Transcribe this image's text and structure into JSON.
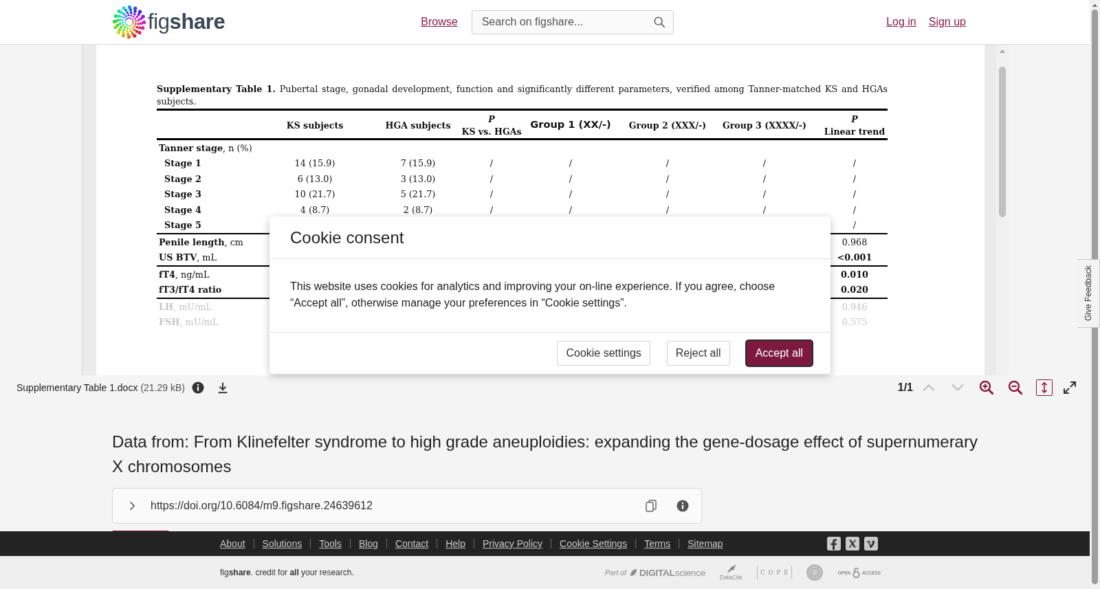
{
  "header": {
    "logo": "fig**share**",
    "nav_link": "Browse",
    "search": {
      "placeholder": "Search on figshare..."
    },
    "account_links": [
      "Log in",
      "Sign up"
    ]
  },
  "viewer": {
    "document": {
      "caption": "**Supplementary Table 1.** Pubertal stage, gonadal development, function and significantly different parameters, verified among Tanner-matched KS and HGAs subjects.",
      "columns": [
        {
          "text": "KS subjects",
          "kind": "serif"
        },
        {
          "text": "HGA subjects",
          "kind": "serif"
        },
        {
          "symbol": "P",
          "text": "KS vs. HGAs",
          "kind": "serif"
        },
        {
          "text": "Group 1 (XX/-)",
          "kind": "sans"
        },
        {
          "text": "Group 2 (XXX/-)",
          "kind": "serif"
        },
        {
          "text": "Group 3 (XXXX/-)",
          "kind": "serif"
        },
        {
          "symbol": "P",
          "text": "Linear trend",
          "kind": "serif"
        }
      ],
      "groups": [
        {
          "rows": [
            {
              "label": "**Tanner stage**, n (%)",
              "kind": "heading",
              "faded": false
            },
            {
              "label": "Stage 1",
              "kind": "sub",
              "faded": false,
              "values": [
                "14 (15.9)",
                "7 (15.9)",
                "/",
                "/",
                "/",
                "/",
                "/"
              ]
            },
            {
              "label": "Stage 2",
              "kind": "sub",
              "faded": false,
              "values": [
                "6 (13.0)",
                "3 (13.0)",
                "/",
                "/",
                "/",
                "/",
                "/"
              ]
            },
            {
              "label": "Stage 3",
              "kind": "sub",
              "faded": false,
              "values": [
                "10 (21.7)",
                "5 (21.7)",
                "/",
                "/",
                "/",
                "/",
                "/"
              ]
            },
            {
              "label": "Stage 4",
              "kind": "sub",
              "faded": false,
              "values": [
                "4 (8.7)",
                "2 (8.7)",
                "/",
                "/",
                "/",
                "/",
                "/"
              ]
            },
            {
              "label": "Stage 5",
              "kind": "sub",
              "faded": false,
              "p_linear_trend": "/",
              "significant": false
            }
          ]
        },
        {
          "rows": [
            {
              "label": "**Penile length**, cm",
              "kind": "item",
              "faded": false,
              "p_linear_trend": "0.968",
              "significant": false
            },
            {
              "label": "**US BTV**, mL",
              "kind": "item",
              "faded": false,
              "p_linear_trend": "<0.001",
              "significant": true
            }
          ]
        },
        {
          "rows": [
            {
              "label": "**fT4**, ng/mL",
              "kind": "item",
              "faded": false,
              "p_linear_trend": "0.010",
              "significant": true
            },
            {
              "label": "**fT3/fT4 ratio**",
              "kind": "item",
              "faded": false,
              "p_linear_trend": "0.020",
              "significant": true
            }
          ]
        },
        {
          "rows": [
            {
              "label": "**LH**, mU/mL",
              "kind": "item",
              "faded": true,
              "p_linear_trend": "0.946",
              "significant": false
            },
            {
              "label": "**FSH**, mU/mL",
              "kind": "item",
              "faded": true,
              "p_linear_trend": "0.575",
              "significant": false
            }
          ]
        }
      ]
    },
    "file": {
      "name": "Supplementary Table 1.docx",
      "size": "(21.29 kB)"
    },
    "page_indicator": "1/1",
    "tools": [
      {
        "kind": "previous",
        "disabled": true,
        "on": false
      },
      {
        "kind": "next",
        "disabled": true,
        "on": false
      },
      {
        "kind": "zoom-in",
        "disabled": false,
        "on": false
      },
      {
        "kind": "zoom-out",
        "disabled": false,
        "on": false
      },
      {
        "kind": "fit-height",
        "disabled": false,
        "on": true
      },
      {
        "kind": "fullscreen",
        "disabled": false,
        "on": false
      }
    ]
  },
  "cookie_dialog": {
    "title": "Cookie consent",
    "message": "This website uses cookies for analytics and improving your on-line experience. If you agree, choose “Accept all”, otherwise manage your preferences in “Cookie settings”.",
    "buttons": [
      {
        "label": "Cookie settings",
        "kind": "secondary",
        "focused": false
      },
      {
        "label": "Reject all",
        "kind": "secondary",
        "focused": false
      },
      {
        "label": "Accept all",
        "kind": "primary",
        "focused": true
      }
    ]
  },
  "article": {
    "title": "Data from: From Klinefelter syndrome to high grade aneuploidies: expanding the gene-dosage effect of supernumerary X chromosomes",
    "doi": {
      "url": "https://doi.org/10.6084/m9.figshare.24639612",
      "expanded": false
    }
  },
  "footer": {
    "links": [
      "About",
      "Solutions",
      "Tools",
      "Blog",
      "Contact",
      "Help",
      "Privacy Policy",
      "Cookie Settings",
      "Terms",
      "Sitemap"
    ],
    "tagline": "fig**share**. credit for **all** your research.",
    "partners": [
      {
        "kind": "digital-science",
        "prefix": "Part of",
        "name": "**DIGITAL**science"
      },
      {
        "kind": "datacite",
        "name": "DataCite"
      },
      {
        "kind": "cope",
        "name": "COPE"
      },
      {
        "kind": "seal"
      },
      {
        "kind": "open-access",
        "prefix": "OPEN",
        "name": "ACCESS"
      }
    ]
  },
  "feedback_tab": "Give Feedback"
}
